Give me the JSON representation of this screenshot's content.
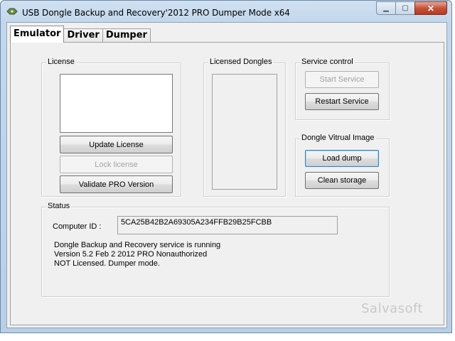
{
  "window": {
    "title": "USB Dongle Backup and Recovery'2012 PRO Dumper Mode x64",
    "minimize_glyph": "▁",
    "maximize_glyph": "▢",
    "close_glyph": "✕"
  },
  "tabs": [
    {
      "label": "Emulator",
      "active": true
    },
    {
      "label": "Driver",
      "active": false
    },
    {
      "label": "Dumper",
      "active": false
    }
  ],
  "license": {
    "group_label": "License",
    "text_value": "",
    "update_label": "Update License",
    "lock_label": "Lock license",
    "validate_label": "Validate PRO Version"
  },
  "licensed_dongles": {
    "group_label": "Licensed Dongles",
    "items": []
  },
  "service_control": {
    "group_label": "Service control",
    "start_label": "Start Service",
    "restart_label": "Restart Service"
  },
  "dongle_image": {
    "group_label": "Dongle Vitrual Image",
    "load_label": "Load dump",
    "clean_label": "Clean storage"
  },
  "status": {
    "group_label": "Status",
    "computer_id_label": "Computer ID :",
    "computer_id_value": "5CA25B42B2A69305A234FFB29B25FCBB",
    "line1": "Dongle Backup and Recovery service is running",
    "line2": "Version 5.2 Feb  2 2012 PRO Nonauthorized",
    "line3": "NOT Licensed. Dumper mode."
  },
  "watermark": "Salvasoft",
  "icons": {
    "app": "dongle-app-icon",
    "minimize": "minimize-icon",
    "maximize": "maximize-icon",
    "close": "close-icon"
  }
}
